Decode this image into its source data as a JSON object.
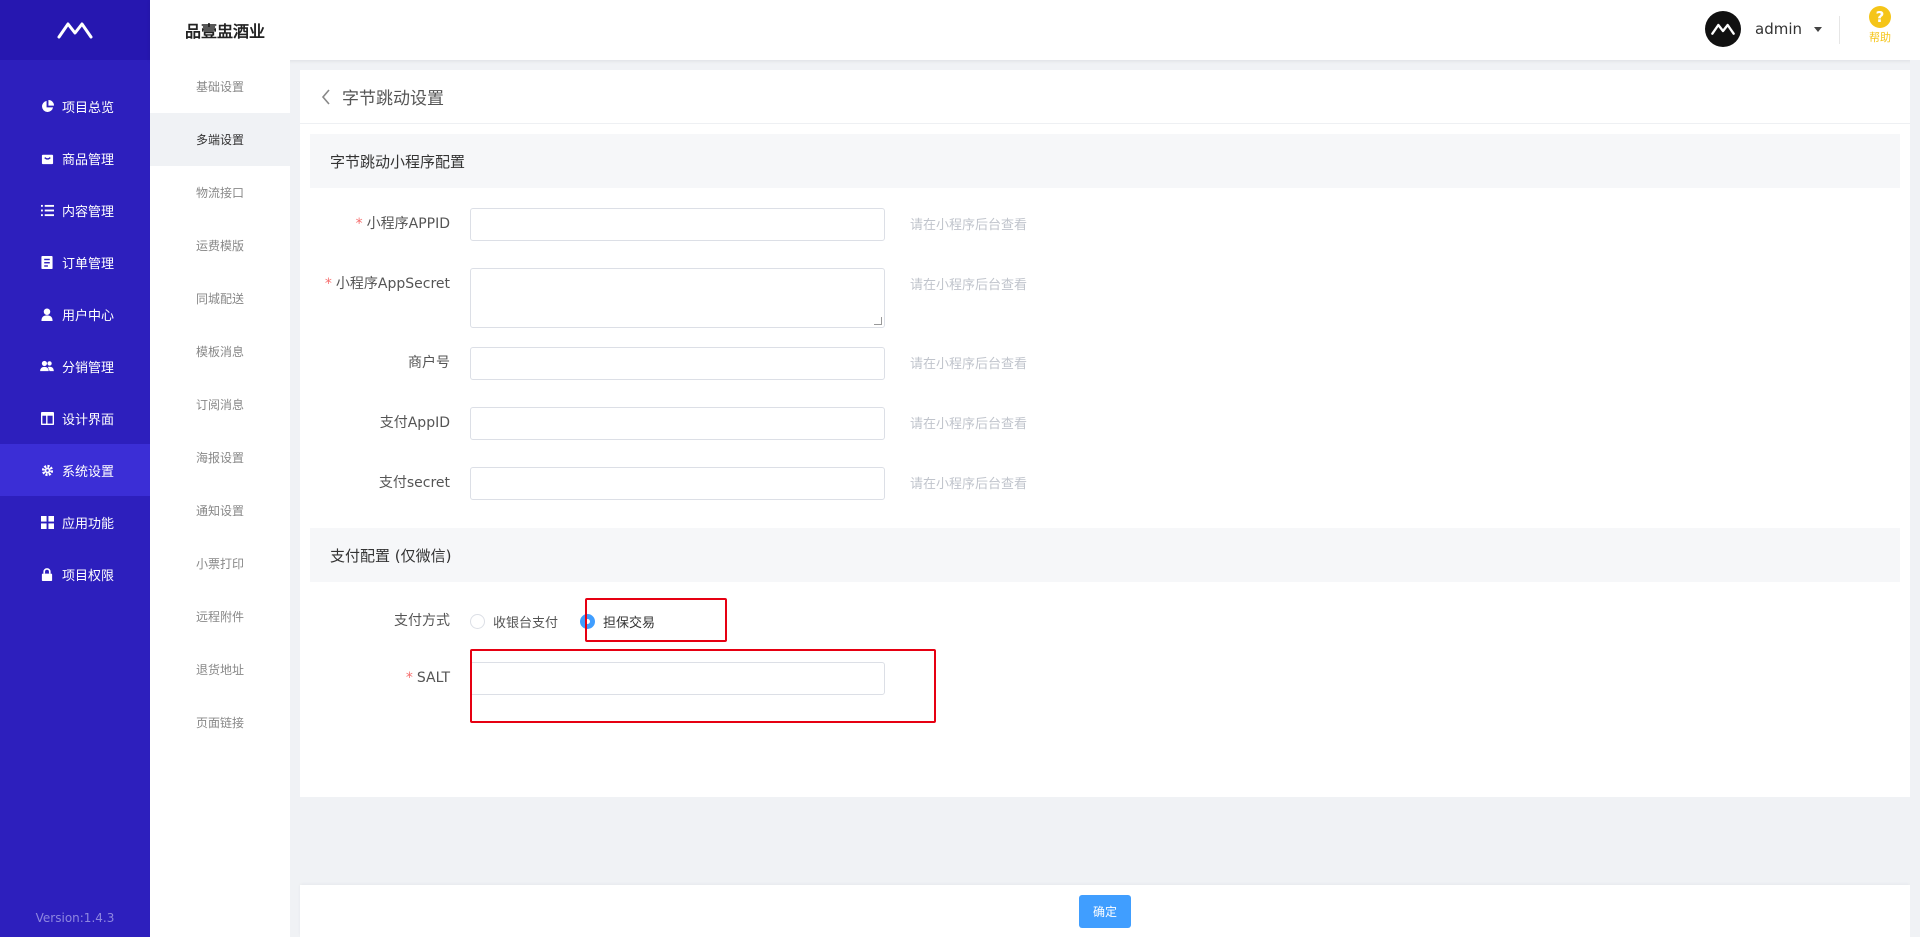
{
  "header": {
    "brand": "品壹盅酒业",
    "user": "admin",
    "help_label": "帮助"
  },
  "sidebar": {
    "items": [
      {
        "label": "项目总览",
        "icon": "pie-chart-icon"
      },
      {
        "label": "商品管理",
        "icon": "shopping-bag-icon"
      },
      {
        "label": "内容管理",
        "icon": "list-icon"
      },
      {
        "label": "订单管理",
        "icon": "order-icon"
      },
      {
        "label": "用户中心",
        "icon": "user-icon"
      },
      {
        "label": "分销管理",
        "icon": "users-icon"
      },
      {
        "label": "设计界面",
        "icon": "layout-icon"
      },
      {
        "label": "系统设置",
        "icon": "gear-icon"
      },
      {
        "label": "应用功能",
        "icon": "grid-icon"
      },
      {
        "label": "项目权限",
        "icon": "lock-icon"
      }
    ],
    "active_index": 7,
    "version": "Version:1.4.3"
  },
  "submenu": {
    "items": [
      "基础设置",
      "多端设置",
      "物流接口",
      "运费模版",
      "同城配送",
      "模板消息",
      "订阅消息",
      "海报设置",
      "通知设置",
      "小票打印",
      "远程附件",
      "退货地址",
      "页面链接"
    ],
    "active_index": 1
  },
  "page": {
    "title": "字节跳动设置",
    "section1_title": "字节跳动小程序配置",
    "section2_title": "支付配置 (仅微信)",
    "fields": {
      "appid": {
        "label": "小程序APPID",
        "required": "*",
        "value": "",
        "hint": "请在小程序后台查看"
      },
      "appsecret": {
        "label": "小程序AppSecret",
        "required": "*",
        "value": "",
        "hint": "请在小程序后台查看"
      },
      "merchant": {
        "label": "商户号",
        "value": "",
        "hint": "请在小程序后台查看"
      },
      "pay_appid": {
        "label": "支付AppID",
        "value": "",
        "hint": "请在小程序后台查看"
      },
      "pay_secret": {
        "label": "支付secret",
        "value": "",
        "hint": "请在小程序后台查看"
      },
      "pay_method": {
        "label": "支付方式",
        "options": [
          "收银台支付",
          "担保交易"
        ],
        "selected": "担保交易"
      },
      "salt": {
        "label": "SALT",
        "required": "*",
        "value": ""
      }
    }
  },
  "footer": {
    "confirm": "确定"
  },
  "colors": {
    "sidebar_bg": "#2d1fbd",
    "primary": "#409eff",
    "highlight": "#e60012",
    "required": "#f56c6c",
    "help": "#f5c518"
  }
}
